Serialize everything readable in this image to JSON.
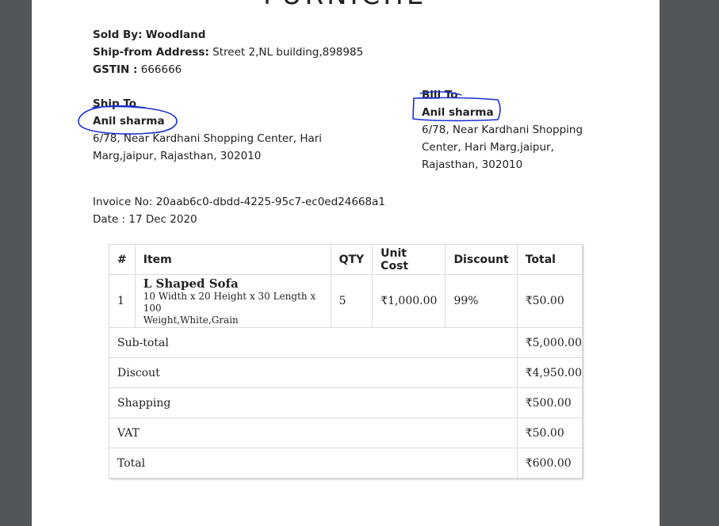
{
  "header": {
    "heading_partial": "FURNICHE"
  },
  "seller": {
    "sold_by_label": "Sold By:",
    "sold_by_value": "Woodland",
    "ship_from_label": "Ship-from Address:",
    "ship_from_value": "Street 2,NL building,898985",
    "gstin_label": "GSTIN :",
    "gstin_value": "666666"
  },
  "ship_to": {
    "title": "Ship To",
    "name": "Anil sharma",
    "address_line1": "6/78, Near Kardhani Shopping Center, Hari",
    "address_line2": "Marg,jaipur, Rajasthan, 302010"
  },
  "bill_to": {
    "title": "Bill To",
    "name": "Anil sharma",
    "address_line1": "6/78, Near Kardhani Shopping",
    "address_line2": "Center, Hari Marg,jaipur,",
    "address_line3": "Rajasthan, 302010"
  },
  "invoice": {
    "number_label": "Invoice No:",
    "number_value": "20aab6c0-dbdd-4225-95c7-ec0ed24668a1",
    "date_label": "Date :",
    "date_value": "17 Dec 2020"
  },
  "table": {
    "headers": {
      "num": "#",
      "item": "Item",
      "qty": "QTY",
      "unit_cost": "Unit Cost",
      "discount": "Discount",
      "total": "Total"
    },
    "rows": [
      {
        "num": "1",
        "name": "L Shaped Sofa",
        "desc_line1": "10 Width x 20 Height x 30 Length x 100",
        "desc_line2": "Weight,White,Grain",
        "qty": "5",
        "unit_cost": "₹1,000.00",
        "discount": "99%",
        "total": "₹50.00"
      }
    ],
    "summary": {
      "subtotal_label": "Sub-total",
      "subtotal_value": "₹5,000.00",
      "discount_label": "Discout",
      "discount_value": "₹4,950.00",
      "shipping_label": "Shapping",
      "shipping_value": "₹500.00",
      "vat_label": "VAT",
      "vat_value": "₹50.00",
      "total_label": "Total",
      "total_value": "₹600.00"
    }
  },
  "colors": {
    "viewer_background": "#525659",
    "page": "#ffffff",
    "pen_annotation": "#1a2fd0"
  }
}
